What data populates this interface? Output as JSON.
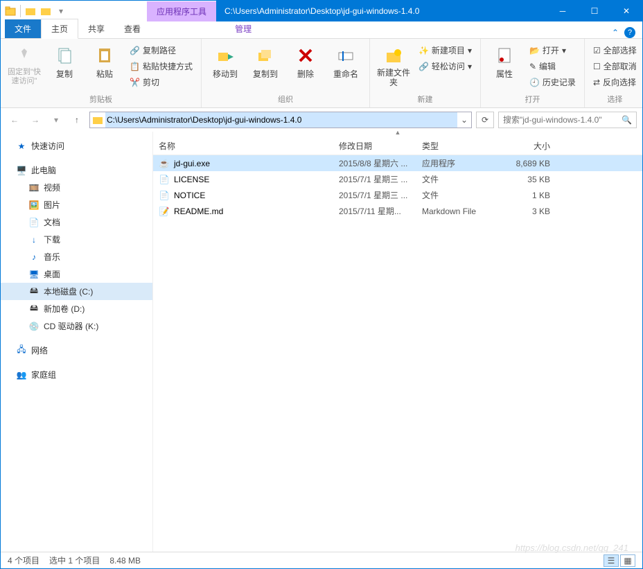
{
  "title": {
    "context_tab": "应用程序工具",
    "path": "C:\\Users\\Administrator\\Desktop\\jd-gui-windows-1.4.0"
  },
  "tabs": {
    "file": "文件",
    "home": "主页",
    "share": "共享",
    "view": "查看",
    "manage": "管理"
  },
  "ribbon": {
    "pin": "固定到\"快速访问\"",
    "copy": "复制",
    "paste": "粘贴",
    "copypath": "复制路径",
    "pasteshortcut": "粘贴快捷方式",
    "cut": "剪切",
    "group_clipboard": "剪贴板",
    "moveto": "移动到",
    "copyto": "复制到",
    "delete": "删除",
    "rename": "重命名",
    "group_organize": "组织",
    "newfolder": "新建文件夹",
    "newitem": "新建项目",
    "easyaccess": "轻松访问",
    "group_new": "新建",
    "properties": "属性",
    "open": "打开",
    "edit": "编辑",
    "history": "历史记录",
    "group_open": "打开",
    "selectall": "全部选择",
    "selectnone": "全部取消",
    "invertsel": "反向选择",
    "group_select": "选择"
  },
  "addressbar": {
    "path": "C:\\Users\\Administrator\\Desktop\\jd-gui-windows-1.4.0",
    "search_placeholder": "搜索\"jd-gui-windows-1.4.0\""
  },
  "sidebar": {
    "quickaccess": "快速访问",
    "thispc": "此电脑",
    "videos": "视频",
    "pictures": "图片",
    "documents": "文档",
    "downloads": "下载",
    "music": "音乐",
    "desktop": "桌面",
    "cdrive": "本地磁盘 (C:)",
    "ddrive": "新加卷 (D:)",
    "cdrom": "CD 驱动器 (K:)",
    "network": "网络",
    "homegroup": "家庭组"
  },
  "columns": {
    "name": "名称",
    "date": "修改日期",
    "type": "类型",
    "size": "大小"
  },
  "files": [
    {
      "name": "jd-gui.exe",
      "date": "2015/8/8 星期六 ...",
      "type": "应用程序",
      "size": "8,689 KB",
      "sel": true,
      "icon": "exe"
    },
    {
      "name": "LICENSE",
      "date": "2015/7/1 星期三 ...",
      "type": "文件",
      "size": "35 KB",
      "sel": false,
      "icon": "file"
    },
    {
      "name": "NOTICE",
      "date": "2015/7/1 星期三 ...",
      "type": "文件",
      "size": "1 KB",
      "sel": false,
      "icon": "file"
    },
    {
      "name": "README.md",
      "date": "2015/7/11 星期...",
      "type": "Markdown File",
      "size": "3 KB",
      "sel": false,
      "icon": "md"
    }
  ],
  "status": {
    "count": "4 个项目",
    "selected": "选中 1 个项目",
    "size": "8.48 MB"
  },
  "watermark": "https://blog.csdn.net/qq_241"
}
